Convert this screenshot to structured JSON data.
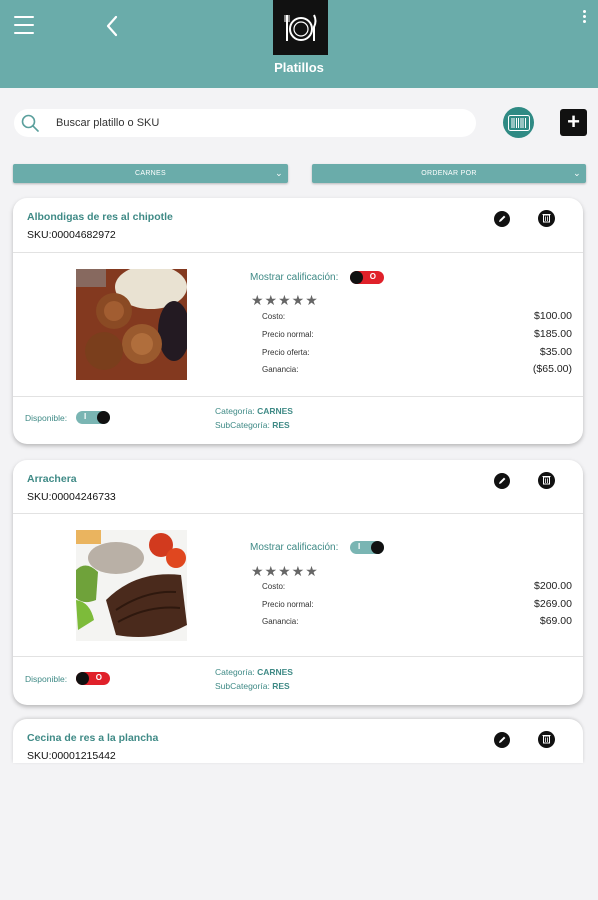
{
  "header": {
    "title": "Platillos",
    "menu_icon": "hamburger-icon",
    "back_icon": "chevron-left-icon",
    "logo_icon": "plate-cutlery-icon",
    "more_icon": "more-vertical-icon",
    "color": "#6aacaa"
  },
  "search": {
    "placeholder": "Buscar platillo o SKU",
    "icon": "search-icon"
  },
  "actions": {
    "scan_icon": "barcode-icon",
    "add_label": "+"
  },
  "filters": {
    "category": "CARNES",
    "order": "ORDENAR POR"
  },
  "products": [
    {
      "name": "Albondigas de res al chipotle",
      "sku": "SKU:00004682972",
      "show_rating_label": "Mostrar calificación:",
      "show_rating_state": "O",
      "stars": "★★★★★",
      "prices": [
        {
          "label": "Costo:",
          "value": "$100.00"
        },
        {
          "label": "Precio normal:",
          "value": "$185.00"
        },
        {
          "label": "Precio oferta:",
          "value": "$35.00"
        },
        {
          "label": "Ganancia:",
          "value": "($65.00)"
        }
      ],
      "available_label": "Disponible:",
      "available_state": "I",
      "category_label": "Categoría:",
      "category": "CARNES",
      "subcategory_label": "SubCategoría:",
      "subcategory": "RES"
    },
    {
      "name": "Arrachera",
      "sku": "SKU:00004246733",
      "show_rating_label": "Mostrar calificación:",
      "show_rating_state": "I",
      "stars": "★★★★★",
      "prices": [
        {
          "label": "Costo:",
          "value": "$200.00"
        },
        {
          "label": "Precio normal:",
          "value": "$269.00"
        },
        {
          "label": "Ganancia:",
          "value": "$69.00"
        }
      ],
      "available_label": "Disponible:",
      "available_state": "O",
      "category_label": "Categoría:",
      "category": "CARNES",
      "subcategory_label": "SubCategoría:",
      "subcategory": "RES"
    },
    {
      "name": "Cecina de res a la plancha",
      "sku": "SKU:00001215442"
    }
  ],
  "colors": {
    "teal": "#6aacaa",
    "dark_teal": "#3f8a86",
    "red_toggle": "#e0212a"
  }
}
